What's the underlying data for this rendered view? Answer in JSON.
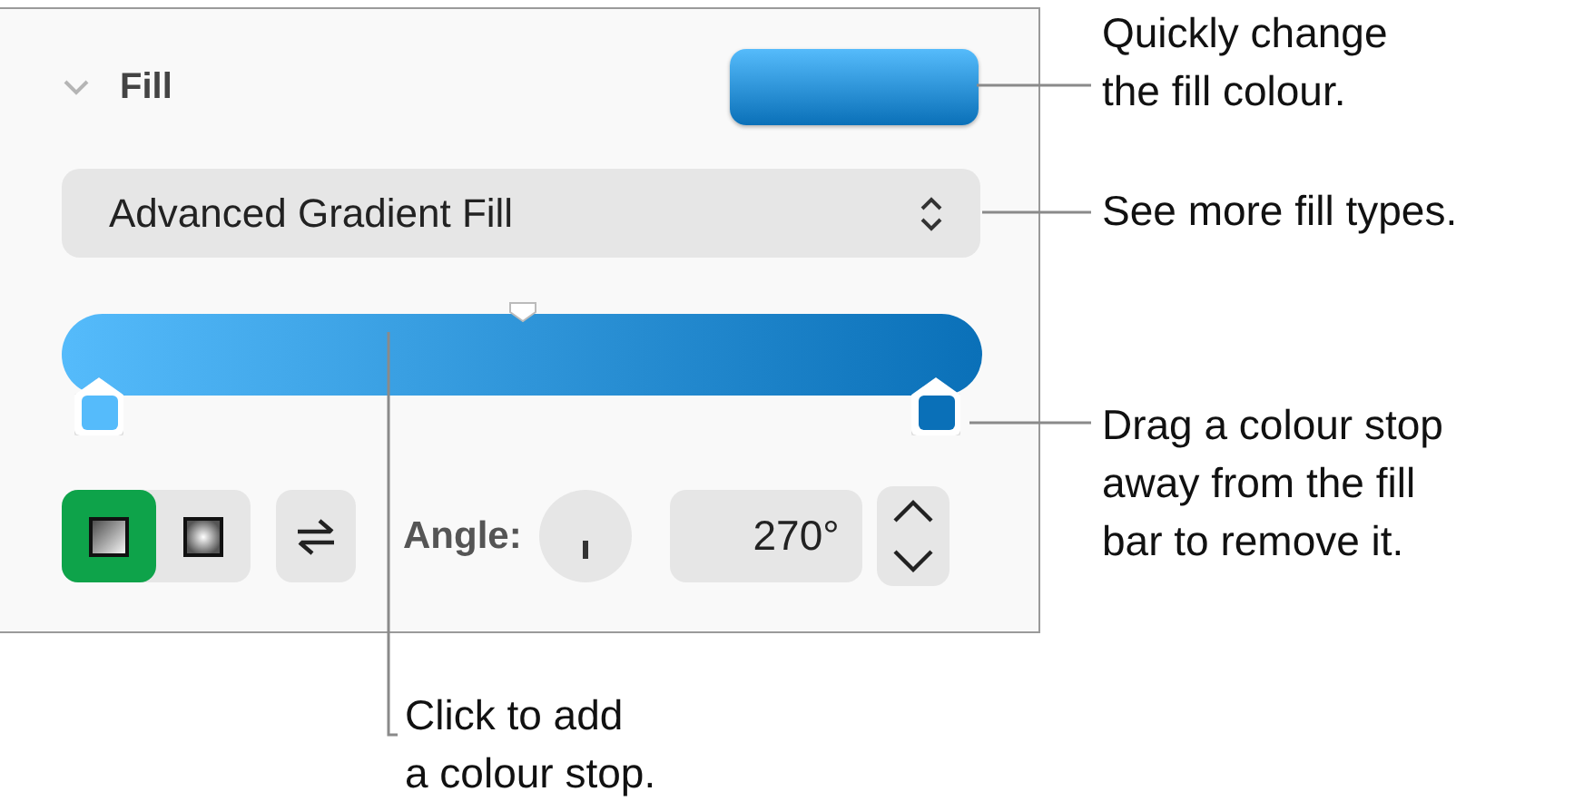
{
  "panel": {
    "title": "Fill",
    "expanded": true,
    "fill_type": "Advanced Gradient Fill",
    "stops": [
      {
        "color": "#55bbfb"
      },
      {
        "color": "#0a70b8"
      }
    ],
    "gradient_types": [
      {
        "kind": "linear",
        "selected": true
      },
      {
        "kind": "radial",
        "selected": false
      }
    ],
    "angle_label": "Angle:",
    "angle_value": "270°"
  },
  "callouts": [
    {
      "kind": "swatch",
      "text": "Quickly change\nthe fill colour."
    },
    {
      "kind": "dropdown",
      "text": "See more fill types."
    },
    {
      "kind": "stop",
      "text": "Drag a colour stop\naway from the fill\nbar to remove it."
    },
    {
      "kind": "bar",
      "text": "Click to add\na colour stop."
    }
  ]
}
